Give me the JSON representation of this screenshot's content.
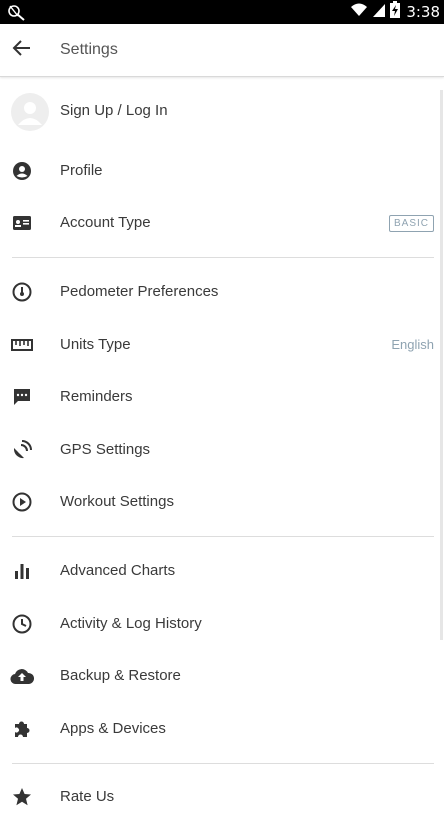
{
  "status_bar": {
    "time": "3:38",
    "icons": [
      "notification-icon",
      "wifi-icon",
      "signal-icon",
      "battery-charging-icon"
    ]
  },
  "app_bar": {
    "back_icon": "arrow-left-icon",
    "title": "Settings"
  },
  "colors": {
    "icon": "#333333",
    "label": "#3a3a3a",
    "secondary": "#8fa3b1",
    "divider": "#dddddd"
  },
  "settings": {
    "sign_up": {
      "label": "Sign Up / Log In",
      "icon": "avatar-placeholder"
    },
    "profile": {
      "label": "Profile",
      "icon": "account-circle-icon"
    },
    "account_type": {
      "label": "Account Type",
      "icon": "id-card-icon",
      "badge": "BASIC"
    },
    "pedometer": {
      "label": "Pedometer Preferences",
      "icon": "speedometer-icon"
    },
    "units": {
      "label": "Units Type",
      "icon": "ruler-icon",
      "value": "English"
    },
    "reminders": {
      "label": "Reminders",
      "icon": "message-icon"
    },
    "gps": {
      "label": "GPS Settings",
      "icon": "satellite-dish-icon"
    },
    "workout": {
      "label": "Workout Settings",
      "icon": "play-circle-icon"
    },
    "charts": {
      "label": "Advanced Charts",
      "icon": "bar-chart-icon"
    },
    "history": {
      "label": "Activity & Log History",
      "icon": "clock-icon"
    },
    "backup": {
      "label": "Backup & Restore",
      "icon": "cloud-upload-icon"
    },
    "apps": {
      "label": "Apps & Devices",
      "icon": "puzzle-icon"
    },
    "rate": {
      "label": "Rate Us",
      "icon": "star-icon"
    }
  }
}
